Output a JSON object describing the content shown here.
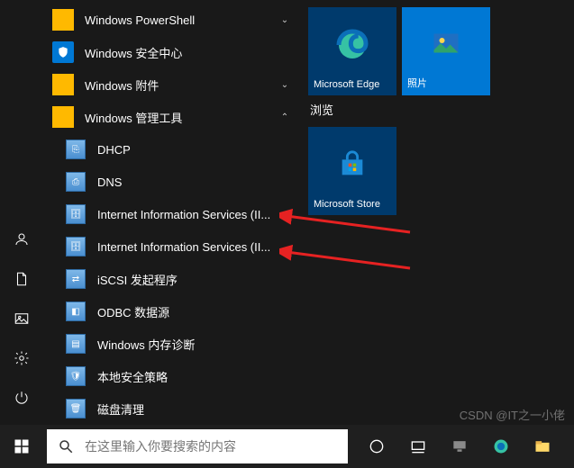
{
  "apps": {
    "powershell": "Windows PowerShell",
    "security": "Windows 安全中心",
    "accessories": "Windows 附件",
    "admintools": "Windows 管理工具",
    "dhcp": "DHCP",
    "dns": "DNS",
    "iis1": "Internet Information Services (II...",
    "iis2": "Internet Information Services (II...",
    "iscsi": "iSCSI 发起程序",
    "odbc": "ODBC 数据源",
    "memdiag": "Windows 内存诊断",
    "secpol": "本地安全策略",
    "diskclean": "磁盘清理"
  },
  "tiles": {
    "edge": "Microsoft Edge",
    "photos": "照片",
    "store": "Microsoft Store"
  },
  "groups": {
    "browse": "浏览"
  },
  "search": {
    "placeholder": "在这里输入你要搜索的内容"
  },
  "watermark": "CSDN @IT之一小佬",
  "colors": {
    "accent": "#0078d4",
    "folder": "#ffb900"
  }
}
